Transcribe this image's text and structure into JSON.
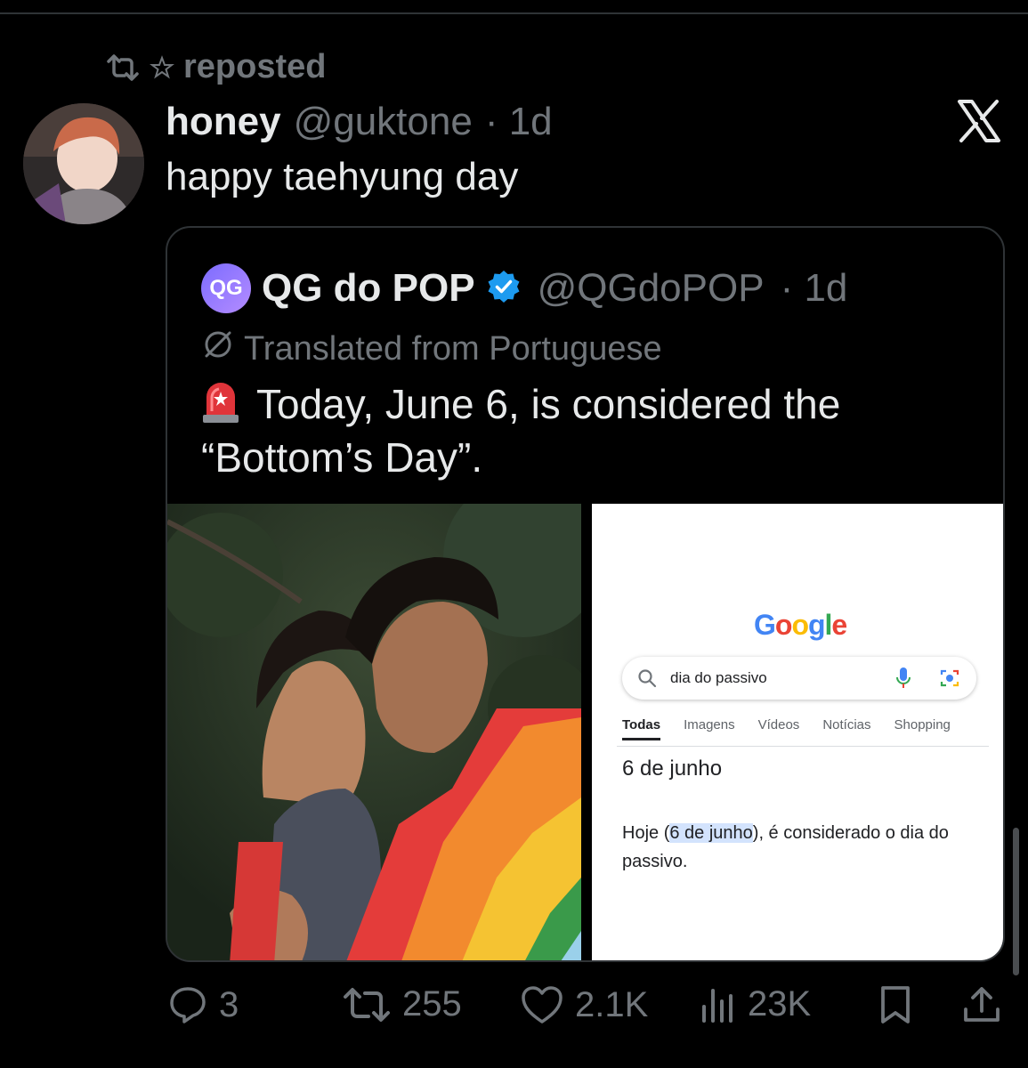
{
  "repost": {
    "label": "reposted"
  },
  "post": {
    "author_name": "honey",
    "author_handle": "@guktone",
    "time": "· 1d",
    "text": "happy taehyung day"
  },
  "quote": {
    "author_name": "QG do POP",
    "author_handle": "@QGdoPOP",
    "time": "· 1d",
    "avatar_initials": "QG",
    "translated_label": "Translated from Portuguese",
    "text": "Today, June 6, is considered the “Bottom’s Day”."
  },
  "google_screenshot": {
    "logo": [
      "G",
      "o",
      "o",
      "g",
      "l",
      "e"
    ],
    "logo_colors": [
      "#4285F4",
      "#EA4335",
      "#FBBC05",
      "#4285F4",
      "#34A853",
      "#EA4335"
    ],
    "search_query": "dia do passivo",
    "tabs": [
      "Todas",
      "Imagens",
      "Vídeos",
      "Notícias",
      "Shopping"
    ],
    "answer": "6 de junho",
    "snippet_before": "Hoje (",
    "snippet_highlight": "6 de junho",
    "snippet_after": "), é considerado o dia do passivo."
  },
  "actions": {
    "replies": "3",
    "reposts": "255",
    "likes": "2.1K",
    "views": "23K"
  },
  "colors": {
    "background": "#000000",
    "text": "#e7e9ea",
    "muted": "#71767b",
    "border": "#2f3336",
    "verified": "#1d9bf0"
  },
  "icons": [
    "repost-icon",
    "star-icon",
    "x-logo-icon",
    "verified-badge-icon",
    "translate-icon",
    "siren-icon",
    "reply-icon",
    "like-icon",
    "views-icon",
    "bookmark-icon",
    "share-icon"
  ]
}
